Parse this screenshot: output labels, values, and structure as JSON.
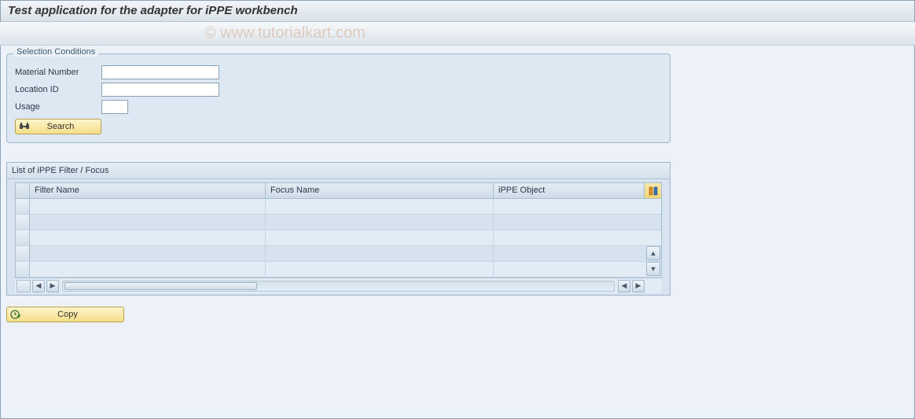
{
  "header": {
    "title": "Test application for the adapter for iPPE workbench"
  },
  "watermark": "© www.tutorialkart.com",
  "selection_box": {
    "title": "Selection Conditions",
    "fields": {
      "material": {
        "label": "Material Number",
        "value": ""
      },
      "location": {
        "label": "Location ID",
        "value": ""
      },
      "usage": {
        "label": "Usage",
        "value": ""
      }
    },
    "search_button": "Search"
  },
  "alv": {
    "title": "List of iPPE Filter / Focus",
    "columns": {
      "c1": "Filter Name",
      "c2": "Focus Name",
      "c3": "iPPE Object"
    }
  },
  "copy_button": "Copy"
}
